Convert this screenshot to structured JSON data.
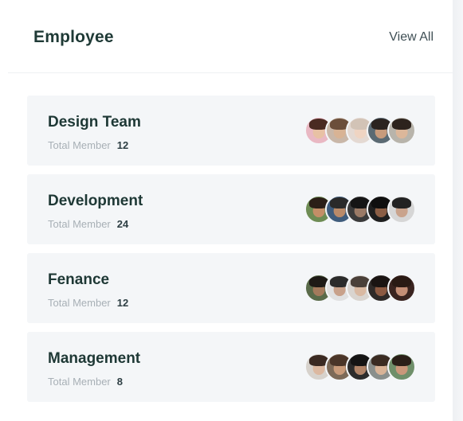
{
  "header": {
    "title": "Employee",
    "view_all_label": "View All"
  },
  "teams": [
    {
      "name": "Design Team",
      "member_label": "Total Member",
      "member_count": "12",
      "avatars": [
        {
          "bg": "#e9b8c3",
          "hair": "#4a2a22",
          "skin": "#e8c1a4"
        },
        {
          "bg": "#c9b7a8",
          "hair": "#6b4e3a",
          "skin": "#d8b394"
        },
        {
          "bg": "#e4d9d2",
          "hair": "#d2c3b6",
          "skin": "#efd4c2"
        },
        {
          "bg": "#5b6a73",
          "hair": "#2a2320",
          "skin": "#c89b7c"
        },
        {
          "bg": "#b8b4ab",
          "hair": "#2d231d",
          "skin": "#dcb79a"
        }
      ]
    },
    {
      "name": "Development",
      "member_label": "Total Member",
      "member_count": "24",
      "avatars": [
        {
          "bg": "#6e8c54",
          "hair": "#2b1f17",
          "skin": "#c48e67"
        },
        {
          "bg": "#3f5c7c",
          "hair": "#2a2a2a",
          "skin": "#b98a69"
        },
        {
          "bg": "#3b3b3b",
          "hair": "#151515",
          "skin": "#9a7a66"
        },
        {
          "bg": "#1f1f1f",
          "hair": "#0f0f0f",
          "skin": "#8b5e45"
        },
        {
          "bg": "#d6d6d6",
          "hair": "#222222",
          "skin": "#c9a38c"
        }
      ]
    },
    {
      "name": "Fenance",
      "member_label": "Total Member",
      "member_count": "12",
      "avatars": [
        {
          "bg": "#5a6b4a",
          "hair": "#1e1a16",
          "skin": "#a47a5c"
        },
        {
          "bg": "#e0e0e0",
          "hair": "#2b2b2b",
          "skin": "#c8a18a"
        },
        {
          "bg": "#d9d4cf",
          "hair": "#4a4039",
          "skin": "#d9b9a2"
        },
        {
          "bg": "#2f2a28",
          "hair": "#1a1412",
          "skin": "#8c5a42"
        },
        {
          "bg": "#3a2420",
          "hair": "#2a1a14",
          "skin": "#c48e76"
        }
      ]
    },
    {
      "name": "Management",
      "member_label": "Total Member",
      "member_count": "8",
      "avatars": [
        {
          "bg": "#d7d2cc",
          "hair": "#3b2a22",
          "skin": "#dcb8a0"
        },
        {
          "bg": "#7d6a58",
          "hair": "#4a3528",
          "skin": "#c99b7a"
        },
        {
          "bg": "#2c2c2c",
          "hair": "#141414",
          "skin": "#b08468"
        },
        {
          "bg": "#8a8f8c",
          "hair": "#3a2b22",
          "skin": "#d8b397"
        },
        {
          "bg": "#6f8f6a",
          "hair": "#2a1f18",
          "skin": "#c9977a"
        }
      ]
    }
  ]
}
